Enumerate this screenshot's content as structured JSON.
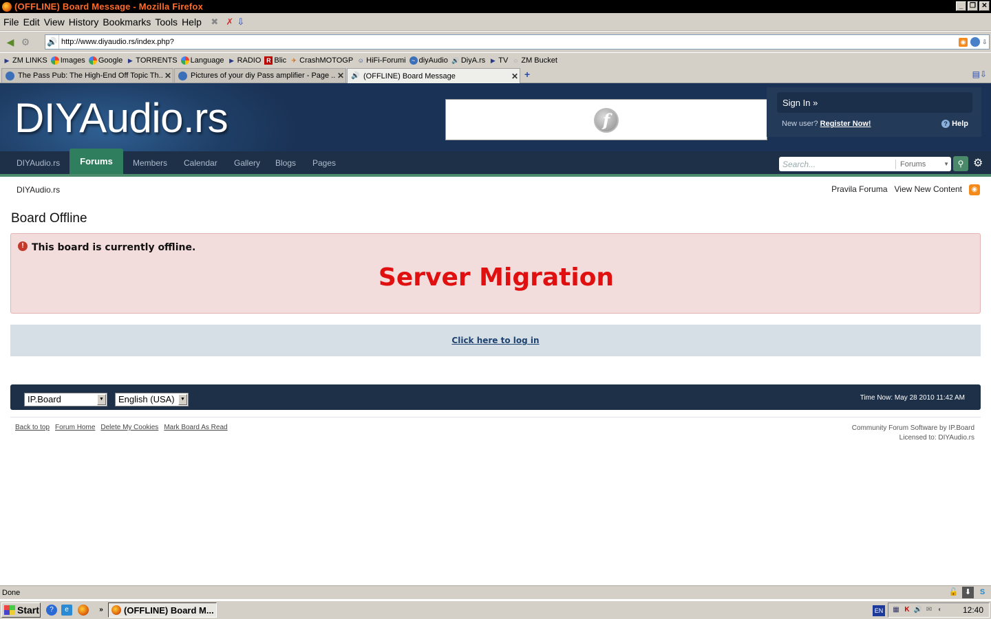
{
  "window": {
    "title": "(OFFLINE) Board Message - Mozilla Firefox",
    "controls": [
      "_",
      "❐",
      "✕"
    ]
  },
  "menubar": {
    "items": [
      {
        "label": "File"
      },
      {
        "label": "Edit"
      },
      {
        "label": "View"
      },
      {
        "label": "History"
      },
      {
        "label": "Bookmarks"
      },
      {
        "label": "Tools"
      },
      {
        "label": "Help"
      }
    ]
  },
  "navbar": {
    "url": "http://www.diyaudio.rs/index.php?"
  },
  "bookmarks": [
    {
      "label": "ZM LINKS",
      "icon": "folder-icon"
    },
    {
      "label": "Images",
      "icon": "google-icon"
    },
    {
      "label": "Google",
      "icon": "google-icon"
    },
    {
      "label": "TORRENTS",
      "icon": "folder-icon"
    },
    {
      "label": "Language",
      "icon": "google-icon"
    },
    {
      "label": "RADIO",
      "icon": "folder-icon"
    },
    {
      "label": "Blic",
      "icon": "blic-icon"
    },
    {
      "label": "CrashMOTOGP",
      "icon": "moto-icon"
    },
    {
      "label": "HiFi-Forumi",
      "icon": "forum-icon"
    },
    {
      "label": "diyAudio",
      "icon": "wave-icon"
    },
    {
      "label": "DiyA.rs",
      "icon": "speaker-icon"
    },
    {
      "label": "TV",
      "icon": "folder-icon"
    },
    {
      "label": "ZM Bucket",
      "icon": "bucket-icon"
    }
  ],
  "tabs": [
    {
      "label": "The Pass Pub: The High-End Off Topic Th..."
    },
    {
      "label": "Pictures of your diy Pass amplifier - Page ..."
    },
    {
      "label": "(OFFLINE) Board Message"
    }
  ],
  "site": {
    "logo": "DIYAudio.rs",
    "sign_in": "Sign In »",
    "new_user": "New user?",
    "register": "Register Now!",
    "help": "Help",
    "nav": [
      {
        "label": "DIYAudio.rs"
      },
      {
        "label": "Forums"
      },
      {
        "label": "Members"
      },
      {
        "label": "Calendar"
      },
      {
        "label": "Gallery"
      },
      {
        "label": "Blogs"
      },
      {
        "label": "Pages"
      }
    ],
    "search_placeholder": "Search...",
    "search_scope": "Forums"
  },
  "content": {
    "breadcrumb": "DIYAudio.rs",
    "top_links": [
      "Pravila Foruma",
      "View New Content"
    ],
    "page_title": "Board Offline",
    "offline_message": "This board is currently offline.",
    "migration_text": "Server Migration",
    "login_link": "Click here to log in"
  },
  "footer": {
    "skin": "IP.Board",
    "language": "English (USA)",
    "time_now": "Time Now: May 28 2010 11:42 AM",
    "links": [
      "Back to top",
      "Forum Home",
      "Delete My Cookies",
      "Mark Board As Read"
    ],
    "software": "Community Forum Software by IP.Board",
    "licensed": "Licensed to: DIYAudio.rs"
  },
  "statusbar": {
    "text": "Done"
  },
  "taskbar": {
    "start": "Start",
    "task_item": "(OFFLINE) Board M...",
    "language": "EN",
    "clock": "12:40"
  },
  "colors": {
    "header_bg": "#1f3f67",
    "nav_bg": "#1d3048",
    "active_tab_green": "#2f7f5f",
    "error_bg": "#f3dcdc",
    "migration_red": "#e01010",
    "login_bg": "#d6dfe6"
  }
}
